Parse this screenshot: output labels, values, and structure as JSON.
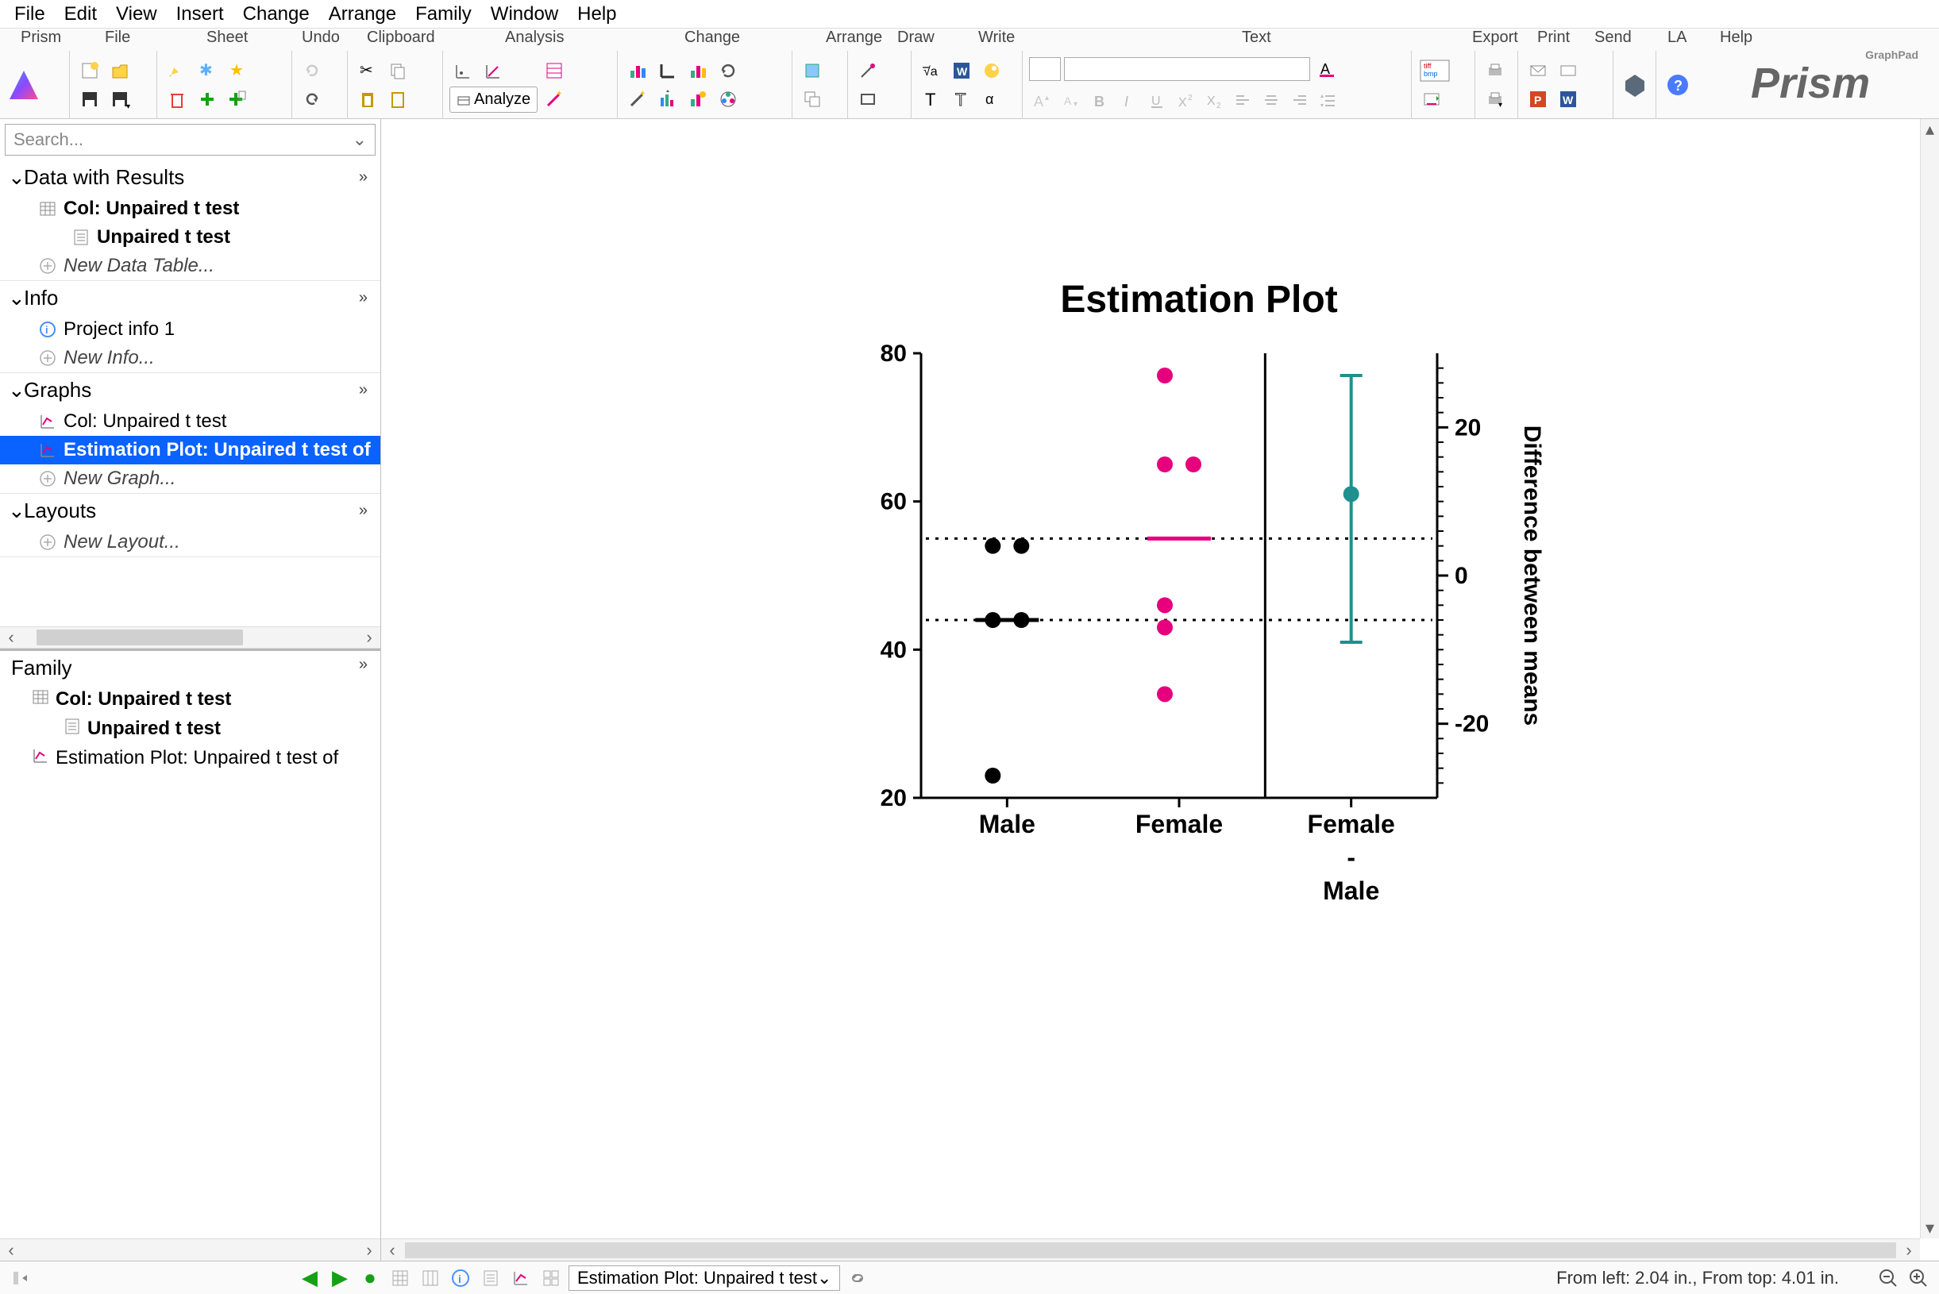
{
  "menu": {
    "items": [
      "File",
      "Edit",
      "View",
      "Insert",
      "Change",
      "Arrange",
      "Family",
      "Window",
      "Help"
    ]
  },
  "ribbon": {
    "groups": [
      "Prism",
      "File",
      "Sheet",
      "Undo",
      "Clipboard",
      "Analysis",
      "Change",
      "Arrange",
      "Draw",
      "Write",
      "Text",
      "Export",
      "Print",
      "Send",
      "LA",
      "Help"
    ],
    "analyze_label": "Analyze",
    "tiff_bmp": "tiff\nbmp"
  },
  "brand": {
    "name": "Prism",
    "tag": "GraphPad"
  },
  "search": {
    "placeholder": "Search..."
  },
  "nav": {
    "sections": [
      {
        "title": "Data with Results",
        "items": [
          {
            "label": "Col: Unpaired t test",
            "bold": true,
            "icon": "table",
            "indent": 1
          },
          {
            "label": "Unpaired t test",
            "bold": true,
            "icon": "results",
            "indent": 2
          },
          {
            "label": "New Data Table...",
            "new": true,
            "icon": "plus",
            "indent": 1
          }
        ]
      },
      {
        "title": "Info",
        "items": [
          {
            "label": "Project info 1",
            "icon": "info",
            "indent": 1
          },
          {
            "label": "New Info...",
            "new": true,
            "icon": "plus",
            "indent": 1
          }
        ]
      },
      {
        "title": "Graphs",
        "items": [
          {
            "label": "Col: Unpaired t test",
            "icon": "graph",
            "indent": 1
          },
          {
            "label": "Estimation Plot: Unpaired t test of",
            "icon": "graph",
            "indent": 1,
            "selected": true,
            "bold": true
          },
          {
            "label": "New Graph...",
            "new": true,
            "icon": "plus",
            "indent": 1
          }
        ]
      },
      {
        "title": "Layouts",
        "items": [
          {
            "label": "New Layout...",
            "new": true,
            "icon": "plus",
            "indent": 1
          }
        ]
      }
    ]
  },
  "family": {
    "title": "Family",
    "items": [
      {
        "label": "Col: Unpaired t test",
        "icon": "table",
        "bold": true,
        "indent": 1
      },
      {
        "label": "Unpaired t test",
        "icon": "results",
        "bold": true,
        "indent": 2
      },
      {
        "label": "Estimation Plot: Unpaired t test of",
        "icon": "graph",
        "bold": false,
        "indent": 1
      }
    ]
  },
  "chart_data": {
    "type": "scatter",
    "title": "Estimation Plot",
    "left_axis": {
      "label": "",
      "ticks": [
        20,
        40,
        60,
        80
      ],
      "range": [
        20,
        80
      ]
    },
    "right_axis": {
      "label": "Difference between means",
      "ticks": [
        -20,
        0,
        20
      ],
      "range": [
        -30,
        30
      ]
    },
    "categories": [
      "Male",
      "Female",
      "Female\n-\nMale"
    ],
    "series": [
      {
        "name": "Male",
        "color": "#000000",
        "values": [
          54,
          54,
          44,
          44,
          23
        ],
        "mean": 44
      },
      {
        "name": "Female",
        "color": "#e6007e",
        "values": [
          77,
          65,
          65,
          46,
          43,
          34
        ],
        "mean": 55
      }
    ],
    "difference": {
      "mean": 11,
      "ci_low": -9,
      "ci_high": 27,
      "color": "#1f8f8f"
    },
    "ref_lines": [
      44,
      55
    ]
  },
  "bottom": {
    "selector": "Estimation Plot: Unpaired t test",
    "status": "From left: 2.04 in., From top: 4.01 in."
  }
}
